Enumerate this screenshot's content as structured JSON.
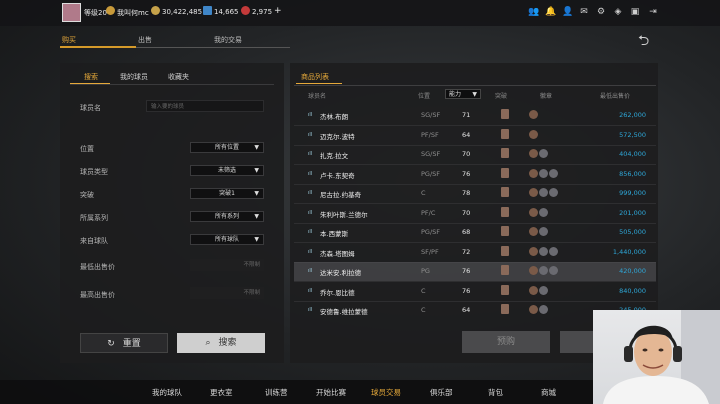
{
  "topbar": {
    "level": "等级20",
    "username": "我叫何mc",
    "currency_gold": "30,422,485",
    "currency_blue": "14,665",
    "currency_red": "2,975",
    "plus": "+",
    "icons": [
      "people-icon",
      "bell-icon",
      "group-icon",
      "mail-icon",
      "gear-icon",
      "shield-icon",
      "mail-alt-icon",
      "exit-icon"
    ]
  },
  "main_tabs": [
    "购买",
    "出售",
    "我的交易"
  ],
  "left": {
    "tabs": [
      "搜索",
      "我的球员",
      "收藏夹"
    ],
    "player_name_label": "球员名",
    "player_name_placeholder": "输入要的球员",
    "filters": [
      {
        "label": "位置",
        "value": "所有位置"
      },
      {
        "label": "球员类型",
        "value": "未筛选"
      },
      {
        "label": "突破",
        "value": "突破1"
      },
      {
        "label": "所属系列",
        "value": "所有系列"
      },
      {
        "label": "来自球队",
        "value": "所有球队"
      }
    ],
    "min_price_label": "最低出售价",
    "max_price_label": "最高出售价",
    "min_price_placeholder": "不限制",
    "max_price_placeholder": "不限制",
    "reset_label": "重置",
    "search_label": "搜索"
  },
  "right": {
    "title": "商品列表",
    "columns": {
      "player": "球员名",
      "position": "位置",
      "ability": "能力",
      "breakthrough": "突破",
      "badge": "徽章",
      "min_price": "最低出售价"
    },
    "rows": [
      {
        "name": "杰林.布朗",
        "pos": "SG/SF",
        "rating": "71",
        "chips": 1,
        "price": "262,000"
      },
      {
        "name": "迈克尔.波特",
        "pos": "PF/SF",
        "rating": "64",
        "chips": 1,
        "price": "572,500"
      },
      {
        "name": "扎克.拉文",
        "pos": "SG/SF",
        "rating": "70",
        "chips": 2,
        "price": "404,000"
      },
      {
        "name": "卢卡.东契奇",
        "pos": "PG/SF",
        "rating": "76",
        "chips": 3,
        "price": "856,000"
      },
      {
        "name": "尼古拉.约基奇",
        "pos": "C",
        "rating": "78",
        "chips": 3,
        "price": "999,000"
      },
      {
        "name": "朱利叶斯.兰德尔",
        "pos": "PF/C",
        "rating": "70",
        "chips": 2,
        "price": "201,000"
      },
      {
        "name": "本.西蒙斯",
        "pos": "PG/SF",
        "rating": "68",
        "chips": 2,
        "price": "505,000"
      },
      {
        "name": "杰森.塔图姆",
        "pos": "SF/PF",
        "rating": "72",
        "chips": 3,
        "price": "1,440,000"
      },
      {
        "name": "达米安.利拉德",
        "pos": "PG",
        "rating": "76",
        "chips": 3,
        "price": "420,000"
      },
      {
        "name": "乔尔.恩比德",
        "pos": "C",
        "rating": "76",
        "chips": 2,
        "price": "840,000"
      },
      {
        "name": "安德鲁.维拉蒙德",
        "pos": "C",
        "rating": "64",
        "chips": 2,
        "price": "245,000"
      }
    ],
    "preorder_label": "预购"
  },
  "bottom_nav": [
    "我的球队",
    "更衣室",
    "训练营",
    "开始比赛",
    "球员交易",
    "俱乐部",
    "背包",
    "商城"
  ]
}
